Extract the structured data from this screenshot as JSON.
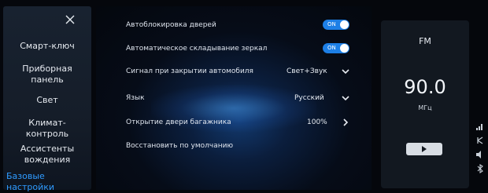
{
  "sidebar": {
    "items": [
      {
        "label": "Смарт-ключ",
        "active": false
      },
      {
        "label": "Приборная\nпанель",
        "active": false
      },
      {
        "label": "Свет",
        "active": false
      },
      {
        "label": "Климат-\nконтроль",
        "active": false
      },
      {
        "label": "Ассистенты\nвождения",
        "active": false
      },
      {
        "label": "Базовые\nнастройки",
        "active": true
      }
    ],
    "close_icon": "close-icon"
  },
  "settings": {
    "rows": [
      {
        "label": "Автоблокировка дверей",
        "control": "toggle",
        "value": "ON"
      },
      {
        "label": "Автоматическое складывание зеркал",
        "control": "toggle",
        "value": "ON"
      },
      {
        "label": "Сигнал при закрытии автомобиля",
        "control": "dropdown",
        "value": "Свет+Звук"
      },
      {
        "label": "Язык",
        "control": "dropdown",
        "value": "Русский"
      },
      {
        "label": "Открытие двери багажника",
        "control": "link",
        "value": "100%"
      },
      {
        "label": "Восстановить по умолчанию",
        "control": "action",
        "value": ""
      }
    ]
  },
  "radio": {
    "band": "FM",
    "frequency": "90.0",
    "unit": "МГц",
    "play_icon": "play-icon"
  },
  "colors": {
    "accent": "#2f9bff",
    "toggle_on": "#1d7fe6",
    "sidebar_bg": "#182230",
    "panel_bg": "#121820"
  }
}
